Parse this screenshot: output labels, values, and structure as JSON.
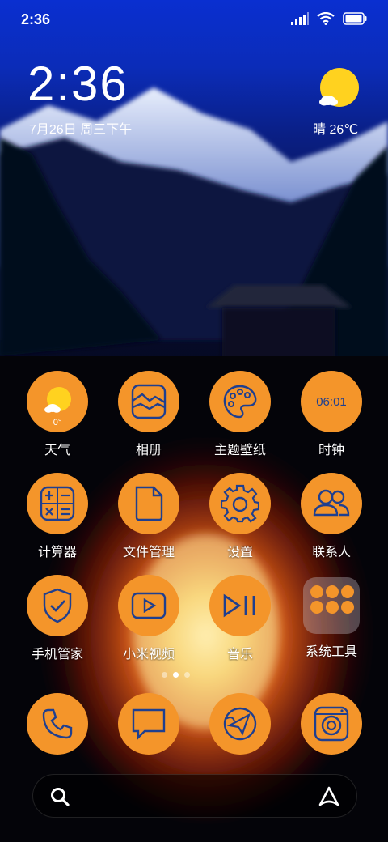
{
  "status_bar": {
    "time": "2:36"
  },
  "clock_widget": {
    "time": "2:36",
    "date": "7月26日 周三下午"
  },
  "weather_widget": {
    "text": "晴 26℃",
    "icon": "sun-cloud-icon"
  },
  "apps": [
    {
      "label": "天气",
      "icon": "weather-icon",
      "extra": "0°"
    },
    {
      "label": "相册",
      "icon": "gallery-icon"
    },
    {
      "label": "主题壁纸",
      "icon": "palette-icon"
    },
    {
      "label": "时钟",
      "icon": "clock-icon",
      "extra": "06:01"
    },
    {
      "label": "计算器",
      "icon": "calculator-icon"
    },
    {
      "label": "文件管理",
      "icon": "file-icon"
    },
    {
      "label": "设置",
      "icon": "gear-icon"
    },
    {
      "label": "联系人",
      "icon": "contacts-icon"
    },
    {
      "label": "手机管家",
      "icon": "shield-icon"
    },
    {
      "label": "小米视频",
      "icon": "video-icon"
    },
    {
      "label": "音乐",
      "icon": "music-icon"
    },
    {
      "label": "系统工具",
      "icon": "folder-icon"
    }
  ],
  "dock": [
    {
      "icon": "phone-icon"
    },
    {
      "icon": "message-icon"
    },
    {
      "icon": "browser-icon"
    },
    {
      "icon": "camera-icon"
    }
  ],
  "colors": {
    "app_bg": "#f4952a",
    "icon_stroke": "#1f3f8f",
    "sun": "#ffd21f"
  }
}
